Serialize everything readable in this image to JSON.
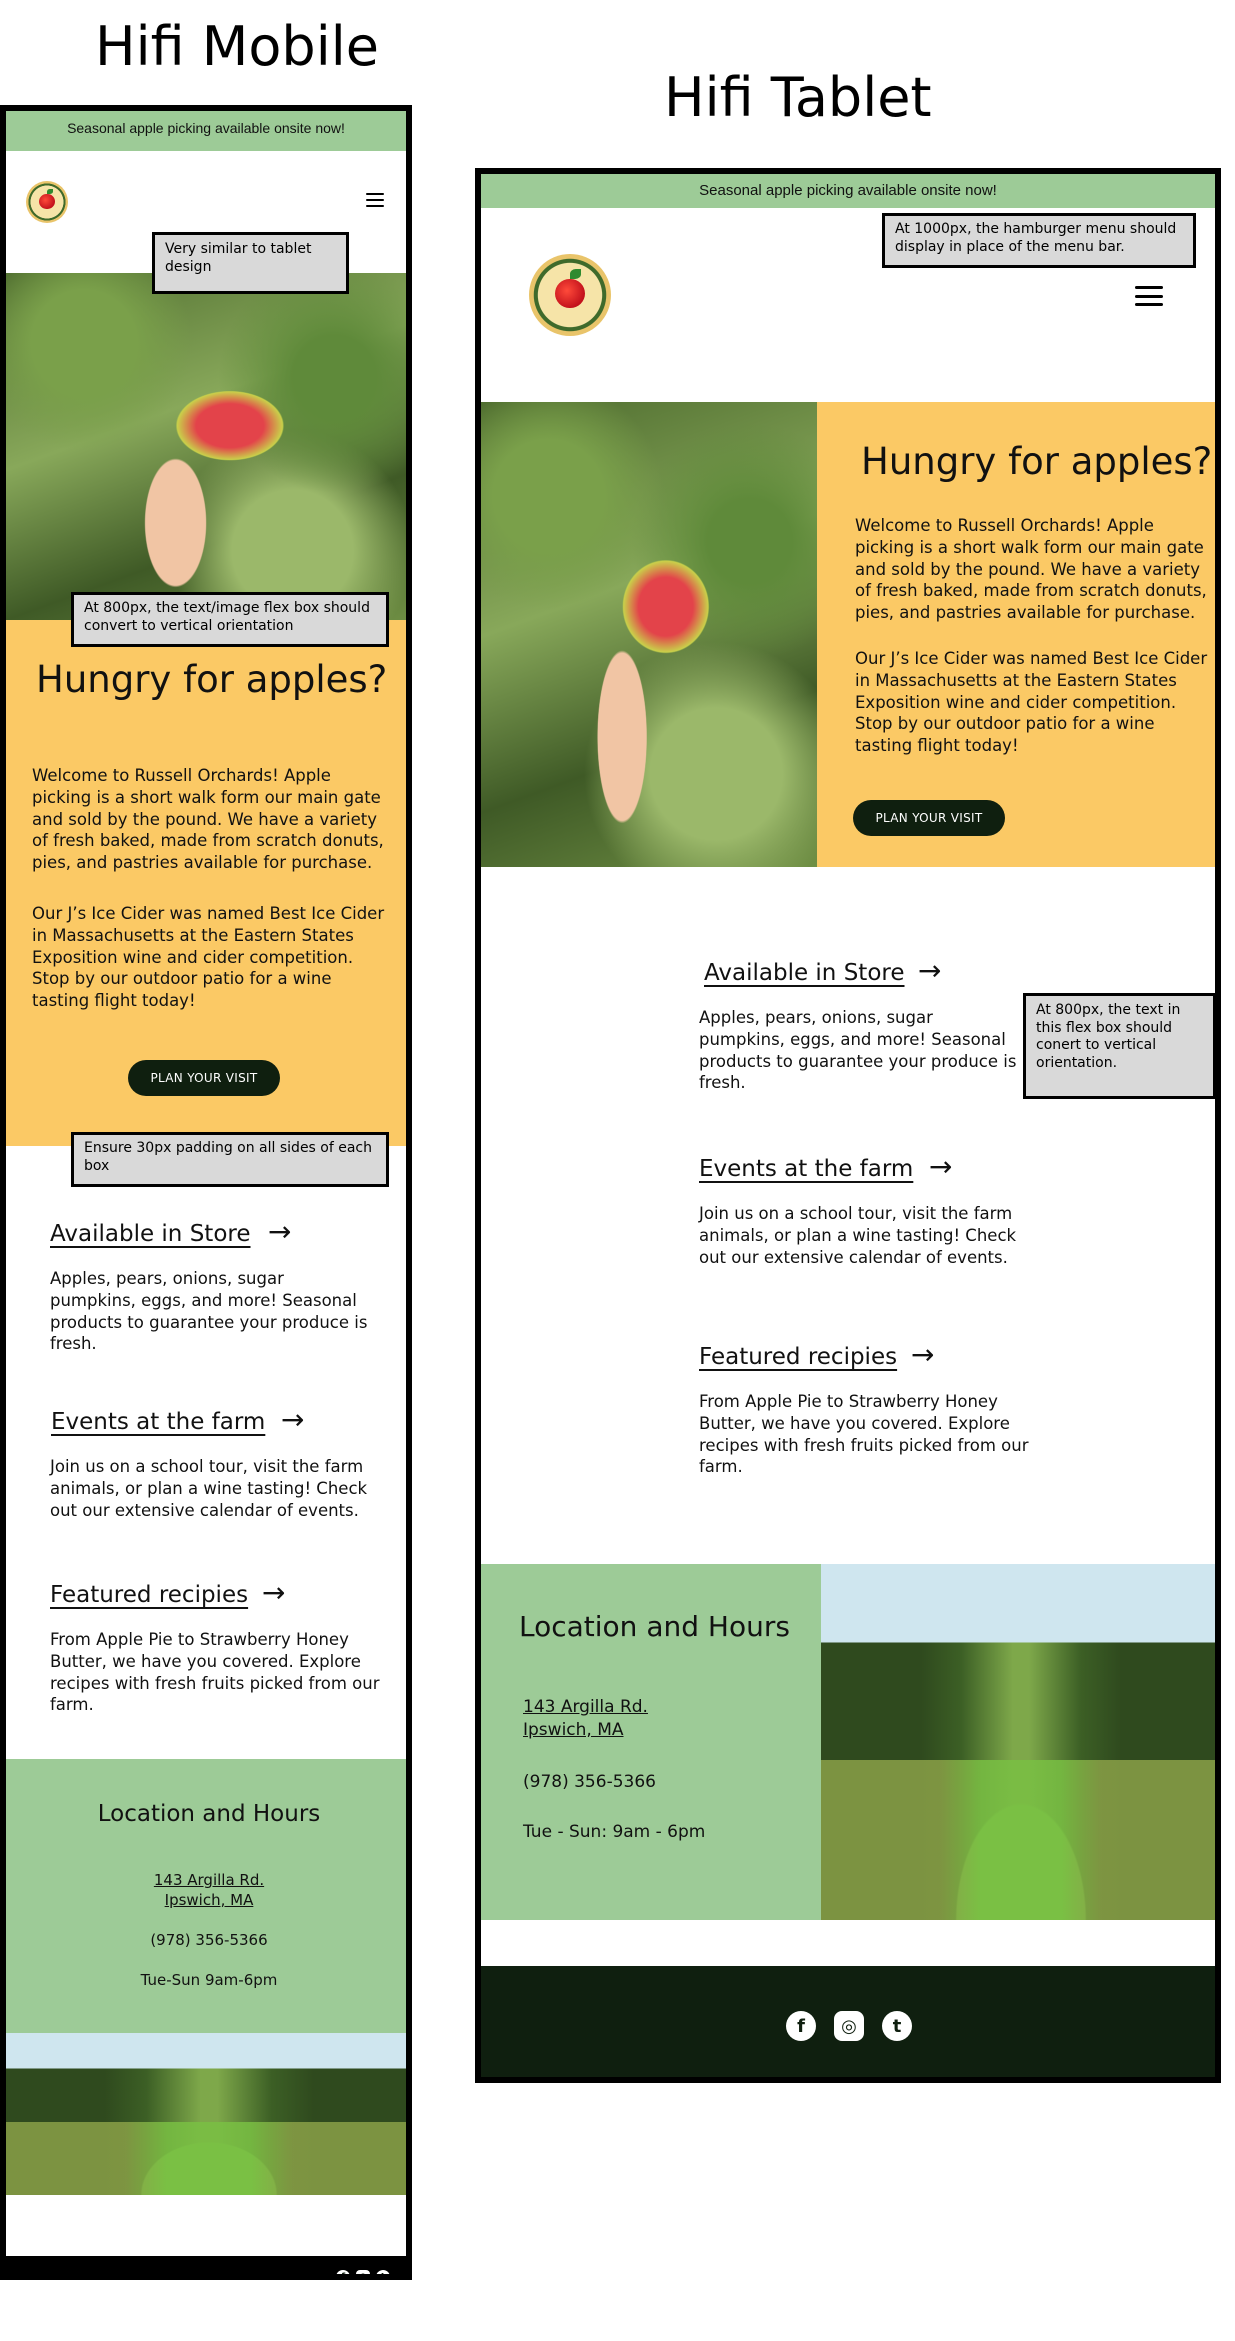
{
  "headings": {
    "mobile": "Hifi Mobile",
    "tablet": "Hifi Tablet"
  },
  "mobile": {
    "banner": "Seasonal apple picking available onsite now!",
    "logo_icon": "russell-orchards-logo",
    "menu_icon": "hamburger-menu-icon",
    "hero_title": "Hungry for apples?",
    "hero_paragraph_1": "Welcome to Russell Orchards! Apple picking is a short walk form our main gate and sold by the pound. We have a variety of fresh baked, made from scratch donuts, pies, and pastries available for purchase.",
    "hero_paragraph_2": "Our J’s Ice Cider was named Best Ice Cider in Massachusetts at the Eastern States Exposition wine and cider competition. Stop by our outdoor patio for a wine tasting flight today!",
    "cta": "PLAN YOUR VISIT",
    "features": [
      {
        "title": "Available in Store",
        "arrow": "→",
        "text": "Apples, pears, onions, sugar pumpkins, eggs, and more! Seasonal products to guarantee your produce is fresh."
      },
      {
        "title": "Events at the farm",
        "arrow": "→",
        "text": "Join us on a school tour, visit the farm animals, or plan a wine tasting! Check out our extensive calendar of events."
      },
      {
        "title": "Featured recipies",
        "arrow": "→",
        "text": "From Apple Pie to Strawberry Honey Butter, we have you covered. Explore recipes with fresh fruits picked from our farm."
      }
    ],
    "location_title": "Location and Hours",
    "address_line_1": "143 Argilla Rd.",
    "address_line_2": "Ipswich, MA",
    "phone": "(978) 356-5366",
    "hours": "Tue-Sun 9am-6pm",
    "social": [
      "f",
      "◎",
      "t"
    ]
  },
  "tablet": {
    "banner": "Seasonal apple picking available onsite now!",
    "logo_icon": "russell-orchards-logo",
    "menu_icon": "hamburger-menu-icon",
    "hero_title": "Hungry for apples?",
    "hero_paragraph_1": "Welcome to Russell Orchards! Apple picking is a short walk form our main gate and sold by the pound. We have a variety of fresh baked, made from scratch donuts, pies, and pastries available for purchase.",
    "hero_paragraph_2": "Our J’s Ice Cider was named Best Ice Cider in Massachusetts at the Eastern States Exposition wine and cider competition. Stop by our outdoor patio for a wine tasting flight today!",
    "cta": "PLAN YOUR VISIT",
    "features": [
      {
        "title": "Available in Store",
        "arrow": "→",
        "text": "Apples, pears, onions, sugar pumpkins, eggs, and more! Seasonal products to guarantee your produce is fresh."
      },
      {
        "title": "Events at the farm",
        "arrow": "→",
        "text": "Join us on a school tour, visit the farm animals, or plan a wine tasting! Check out our extensive calendar of events."
      },
      {
        "title": "Featured recipies",
        "arrow": "→",
        "text": "From Apple Pie to Strawberry Honey Butter, we have you covered. Explore recipes with fresh fruits picked from our farm."
      }
    ],
    "location_title": "Location and Hours",
    "address_line_1": "143 Argilla Rd.",
    "address_line_2": "Ipswich, MA",
    "phone": "(978) 356-5366",
    "hours": "Tue - Sun: 9am - 6pm",
    "social": [
      "f",
      "◎",
      "t"
    ]
  },
  "notes": {
    "mobile_header": "Very similar to tablet design",
    "mobile_flex": "At 800px, the text/image flex box should convert to vertical orientation",
    "mobile_padding": "Ensure 30px padding on all sides of each box",
    "tablet_menu": "At 1000px, the hamburger menu should display in place of the menu bar.",
    "tablet_flex": "At 800px, the text in this flex box should conert to vertical orientation."
  },
  "colors": {
    "banner_green": "#9dcb97",
    "hero_yellow": "#fbc965",
    "footer_dark": "#0f1f0f",
    "mobile_footer": "#000000"
  }
}
